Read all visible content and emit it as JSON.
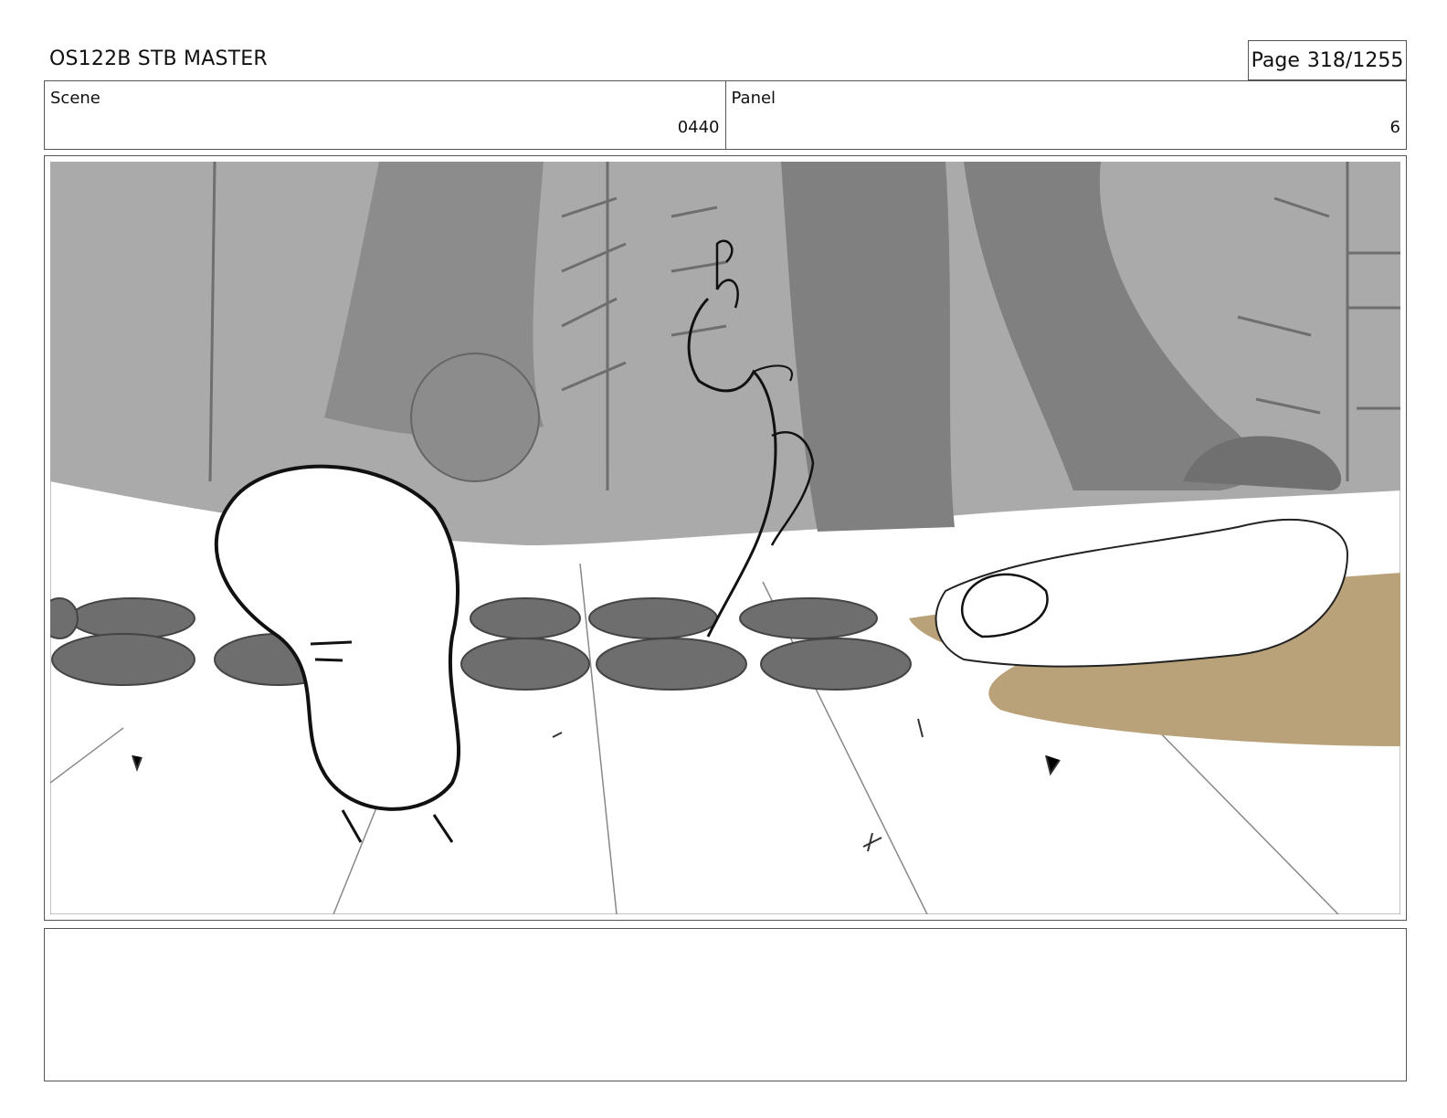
{
  "header": {
    "title": "OS122B STB MASTER",
    "page_label": "Page",
    "page_number": "318/1255"
  },
  "info": {
    "scene_label": "Scene",
    "scene_value": "0440",
    "panel_label": "Panel",
    "panel_value": "6"
  },
  "panel": {
    "image_semantic": "storyboard-sketch",
    "colors": {
      "sky_gray": "#aaaaaa",
      "dark_gray": "#808080",
      "rug_tan": "#b9a27a"
    }
  },
  "notes": {
    "text": ""
  }
}
